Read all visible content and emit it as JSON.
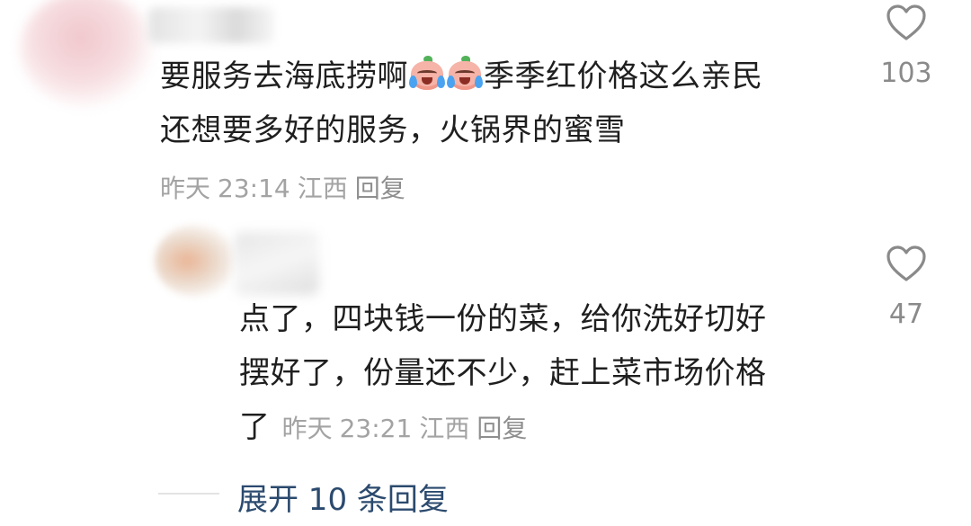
{
  "comments": [
    {
      "text_part1": "要服务去海底捞啊",
      "emojis": [
        "crying-peach-emoji",
        "crying-peach-emoji"
      ],
      "text_part2": "季季红价格这么亲民",
      "line2": "还想要多好的服务，火锅界的蜜雪",
      "date": "昨天",
      "time": "23:14",
      "location": "江西",
      "reply_label": "回复",
      "likes": "103",
      "like_icon": "heart-outline-icon"
    },
    {
      "line1": "点了，四块钱一份的菜，给你洗好切好",
      "line2": "摆好了，份量还不少，赶上菜市场价格",
      "line3": "了",
      "date": "昨天",
      "time": "23:21",
      "location": "江西",
      "reply_label": "回复",
      "likes": "47",
      "like_icon": "heart-outline-icon"
    }
  ],
  "expand_replies": "展开 10 条回复",
  "colors": {
    "text": "#1f1f1f",
    "meta": "#a3a3a3",
    "link": "#2b4a6e",
    "like_count": "#8a8a8a"
  }
}
